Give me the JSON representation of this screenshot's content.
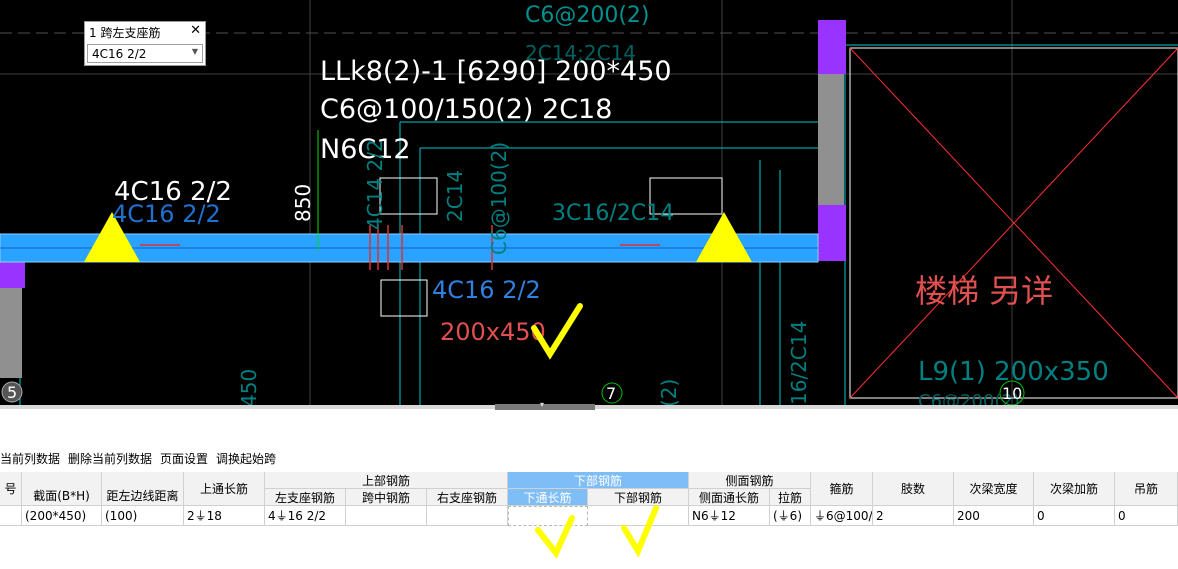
{
  "cad": {
    "beam_label_line1": "LLk8(2)-1 [6290] 200*450",
    "beam_label_line2": "C6@100/150(2) 2C18",
    "beam_label_line3": "N6C12",
    "support_left_white": "4C16 2/2",
    "support_left_blue": "4C16 2/2",
    "dim_850": "850",
    "top_faint_label": "C6@200(2)",
    "top_faint_label2": "2C14;2C14",
    "vert_4c14": "4C14 2/2",
    "vert_2c14": "2C14",
    "vert_c6": "C6@100(2)",
    "right_3c16": "3C16/2C14",
    "bottom_4c16": "4C16 2/2",
    "size_label": "200x450",
    "stair_label": "楼梯 另详",
    "l9_label": "L9(1) 200x350",
    "l9_sub": "C6@200(2)",
    "right_vert_label": "16/2C14",
    "bottom_left_vert": "450",
    "bottom_mid_vert": "(2)",
    "axis_5": "5",
    "axis_7": "7",
    "axis_10": "10"
  },
  "popup": {
    "title": "1 跨左支座筋",
    "value": "4C16 2/2"
  },
  "toolbar": {
    "items": [
      "当前列数据",
      "删除当前列数据",
      "页面设置",
      "调换起始跨"
    ]
  },
  "table": {
    "header_row1": {
      "col0": "号",
      "section": "截面(B*H)",
      "dist": "距左边线距离",
      "top_through": "上通长筋",
      "top_group": "上部钢筋",
      "bottom_group": "下部钢筋",
      "side_group": "侧面钢筋",
      "stirrup": "箍筋",
      "legs": "肢数",
      "sec_beam_width": "次梁宽度",
      "sec_beam_add": "次梁加筋",
      "hanger": "吊筋"
    },
    "header_row2": {
      "left_support": "左支座钢筋",
      "mid_span": "跨中钢筋",
      "right_support": "右支座钢筋",
      "bottom_through": "下通长筋",
      "bottom_bars": "下部钢筋",
      "side_through": "侧面通长筋",
      "tie": "拉筋"
    },
    "row": {
      "section": "(200*450)",
      "dist": "(100)",
      "top_through": "2⏚18",
      "left_support": "4⏚16 2/2",
      "mid_span": "",
      "right_support": "",
      "bottom_through": "",
      "bottom_bars": "",
      "side_through": "N6⏚12",
      "tie": "(⏚6)",
      "stirrup": "⏚6@100/",
      "legs": "2",
      "sec_beam_width": "200",
      "sec_beam_add": "0",
      "hanger": "0"
    }
  },
  "colors": {
    "beam": "#2aa2ff",
    "support_triangle": "#ffff00",
    "wall_purple": "#9933ff",
    "cyan_line": "#00c8c8",
    "red_text": "#e05050",
    "check_yellow": "#ffff00",
    "header_blue": "#7fbdf6"
  }
}
